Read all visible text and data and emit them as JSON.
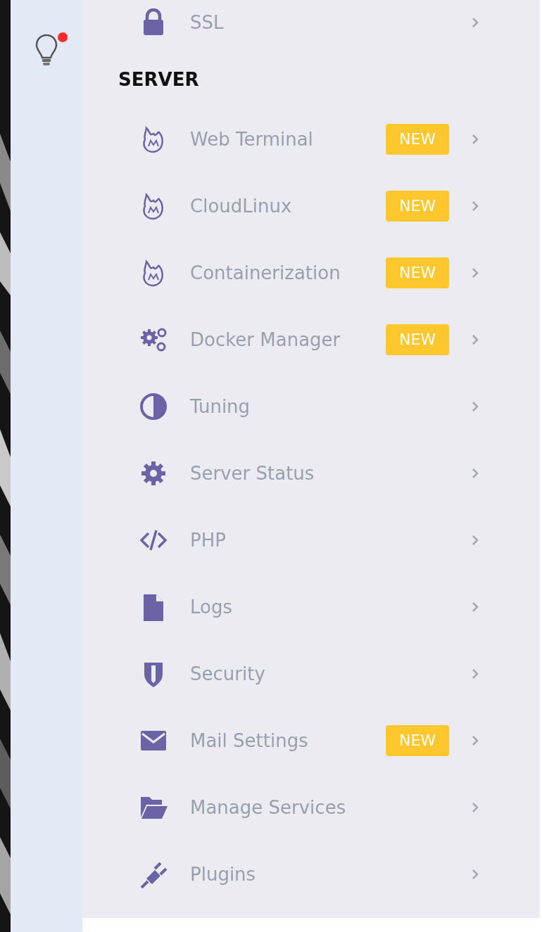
{
  "rail": {
    "notification": true
  },
  "menu": {
    "sections": [
      {
        "items": [
          {
            "label": "SSL",
            "kind": "lock"
          }
        ]
      },
      {
        "title": "SERVER",
        "items": [
          {
            "label": "Web Terminal",
            "kind": "fire",
            "badge": "NEW"
          },
          {
            "label": "CloudLinux",
            "kind": "fire",
            "badge": "NEW"
          },
          {
            "label": "Containerization",
            "kind": "fire",
            "badge": "NEW"
          },
          {
            "label": "Docker Manager",
            "kind": "gears",
            "badge": "NEW"
          },
          {
            "label": "Tuning",
            "kind": "contrast"
          },
          {
            "label": "Server Status",
            "kind": "gear"
          },
          {
            "label": "PHP",
            "kind": "code"
          },
          {
            "label": "Logs",
            "kind": "file"
          },
          {
            "label": "Security",
            "kind": "shield"
          },
          {
            "label": "Mail Settings",
            "kind": "envelope",
            "badge": "NEW"
          },
          {
            "label": "Manage Services",
            "kind": "folder"
          },
          {
            "label": "Plugins",
            "kind": "plug"
          }
        ]
      }
    ]
  }
}
